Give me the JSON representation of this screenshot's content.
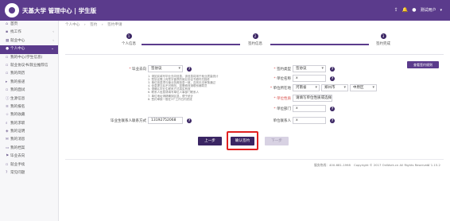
{
  "header": {
    "title": "天基大学 管理中心 | 学生版",
    "user_name": "测试用户",
    "icons": [
      "share-icon",
      "bell-icon",
      "user-icon"
    ]
  },
  "sidebar": {
    "items": [
      {
        "label": "首页",
        "icon": "home-icon"
      },
      {
        "label": "找工作",
        "icon": "briefcase-icon",
        "arrow": "‹"
      },
      {
        "label": "就业中心",
        "icon": "grid-icon",
        "arrow": "‹"
      },
      {
        "label": "个人中心",
        "icon": "user-icon",
        "arrow": "⌄",
        "active": true
      },
      {
        "label": "我的中心(学生信息)",
        "icon": "doc-icon"
      },
      {
        "label": "就业协议书/就业推荐信",
        "icon": "doc-icon"
      },
      {
        "label": "我的简历",
        "icon": "file-icon"
      },
      {
        "label": "我的投递",
        "icon": "send-icon"
      },
      {
        "label": "我的面试",
        "icon": "calendar-icon"
      },
      {
        "label": "生源信息",
        "icon": "info-icon"
      },
      {
        "label": "我的报名",
        "icon": "list-icon"
      },
      {
        "label": "我的收藏",
        "icon": "star-icon"
      },
      {
        "label": "我的求职",
        "icon": "search-icon"
      },
      {
        "label": "我的证明",
        "icon": "badge-icon"
      },
      {
        "label": "我的消息",
        "icon": "message-icon"
      },
      {
        "label": "我的档案",
        "icon": "folder-icon"
      },
      {
        "label": "毕业去向",
        "icon": "flag-icon"
      },
      {
        "label": "就业手续",
        "icon": "doc-icon"
      },
      {
        "label": "常见问题",
        "icon": "question-icon"
      }
    ]
  },
  "breadcrumb": [
    "个人中心",
    "签约",
    "签约申请"
  ],
  "steps": [
    "个人信息",
    "签约信息",
    "签约完成"
  ],
  "form": {
    "corner_button": "查看签约规则",
    "left": {
      "status_label": "毕业去向",
      "status_value": "签协议",
      "contact_label": "毕业生联系人联系方式",
      "contact_value": "13192752068"
    },
    "notes": [
      "1. 请如实填写毕业去向信息，该信息将用于就业质量统计",
      "2. 签协议需上传签字盖章的就业协议书原件扫描件",
      "3. 单位信息须与营业执照信息一致，否则无法审核通过",
      "4. 信息提交后不可修改，如需修改请联系辅导员",
      "5. 请确认毕业生联系方式真实有效",
      "6. 联系人信息请填写单位人事部门联系人",
      "7. 单位地址请精确到区县，便于统计",
      "8. 签约审核一般在3个工作日内完成"
    ],
    "right": {
      "type_label": "签约类型",
      "type_value": "签协议",
      "company_label": "单位名称",
      "company_value": "x",
      "area_label": "单位所在地",
      "area_province": "河南省",
      "area_city": "郑州市",
      "area_district": "中原区",
      "nature_label": "单位性质",
      "nature_value": "请填写单位性质或选择",
      "dept_label": "单位部门",
      "dept_value": "x",
      "person_label": "单位联系人",
      "person_value": "x"
    }
  },
  "buttons": {
    "prev": "上一步",
    "confirm": "确认签约",
    "next": "下一步"
  },
  "footer": {
    "hotline": "服务热线：400-681-1998",
    "copyright": "Copyright © 2017 OnWork.cn All Rights Reserved",
    "version": "V 1.15.2"
  }
}
